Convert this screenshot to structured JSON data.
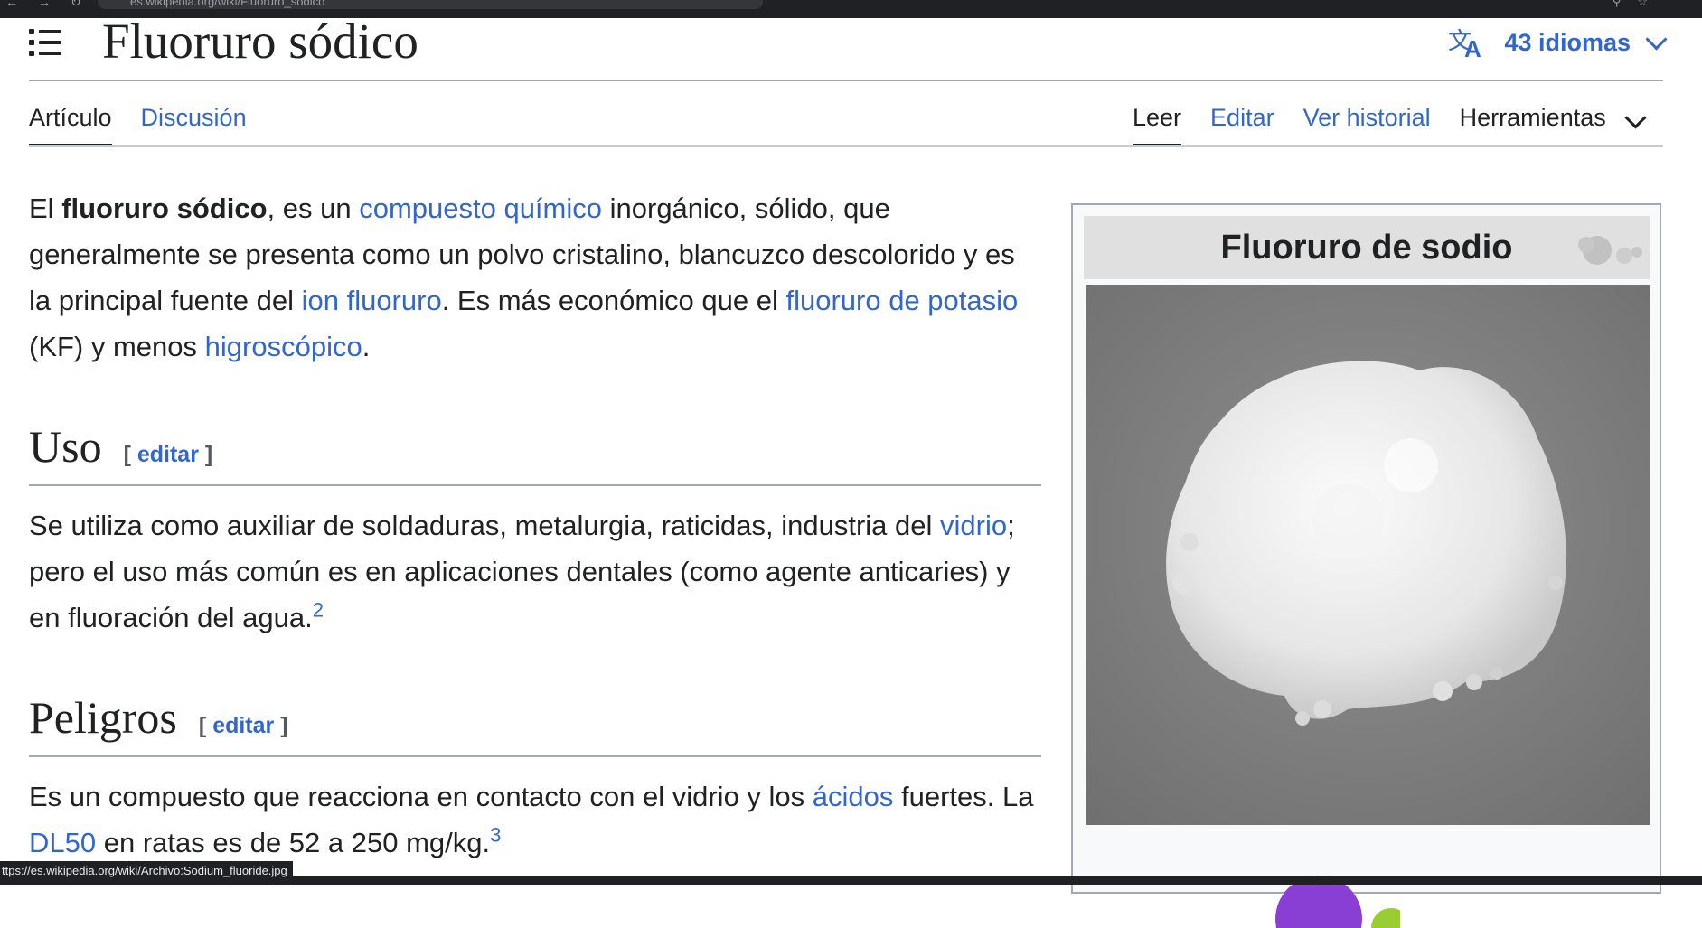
{
  "browser": {
    "url": "es.wikipedia.org/wiki/Fluoruro_sódico"
  },
  "header": {
    "title": "Fluoruro sódico",
    "languages_label": "43 idiomas"
  },
  "tabs": {
    "left": [
      {
        "label": "Artículo",
        "selected": true
      },
      {
        "label": "Discusión",
        "selected": false
      }
    ],
    "right": [
      {
        "label": "Leer",
        "selected": true
      },
      {
        "label": "Editar",
        "selected": false
      },
      {
        "label": "Ver historial",
        "selected": false
      },
      {
        "label": "Herramientas",
        "selected": false
      }
    ]
  },
  "intro": {
    "t1": "El ",
    "bold": "fluoruro sódico",
    "t2": ", es un ",
    "link1": "compuesto químico",
    "t3": " inorgánico, sólido, que generalmente se presenta como un polvo cristalino, blancuzco descolorido y es la principal fuente del ",
    "link2": "ion fluoruro",
    "t4": ". Es más económico que el ",
    "link3": "fluoruro de potasio",
    "t5": " (KF) y menos ",
    "link4": "higroscópico",
    "t6": "."
  },
  "sections": [
    {
      "heading": "Uso",
      "edit_open": "[ ",
      "edit_label": "editar",
      "edit_close": " ]",
      "t1": "Se utiliza como auxiliar de soldaduras, metalurgia, raticidas, industria del ",
      "link1": "vidrio",
      "t2": "; pero el uso más común es en aplicaciones dentales (como agente anticaries) y en fluoración del agua.",
      "ref": "2"
    },
    {
      "heading": "Peligros",
      "edit_open": "[ ",
      "edit_label": "editar",
      "edit_close": " ]",
      "t1": "Es un compuesto que reacciona en contacto con el vidrio y los ",
      "link1": "ácidos",
      "t2": " fuertes. La ",
      "link2": "DL50",
      "t3": " en ratas es de 52 a 250 mg/kg.",
      "ref": "3"
    }
  ],
  "infobox": {
    "title": "Fluoruro de sodio"
  },
  "status_bar": {
    "link_url": "ttps://es.wikipedia.org/wiki/Archivo:Sodium_fluoride.jpg"
  },
  "colors": {
    "link": "#3366cc",
    "text": "#202122",
    "rule": "#a2a9b1",
    "infobox_title_bg": "#e0e0e0",
    "browser_chrome": "#202124"
  },
  "icons": [
    "menu-list-icon",
    "translate-icon",
    "chevron-down-icon",
    "molecule-icon",
    "back-icon",
    "forward-icon",
    "reload-icon",
    "site-info-icon",
    "star-icon",
    "search-icon"
  ]
}
